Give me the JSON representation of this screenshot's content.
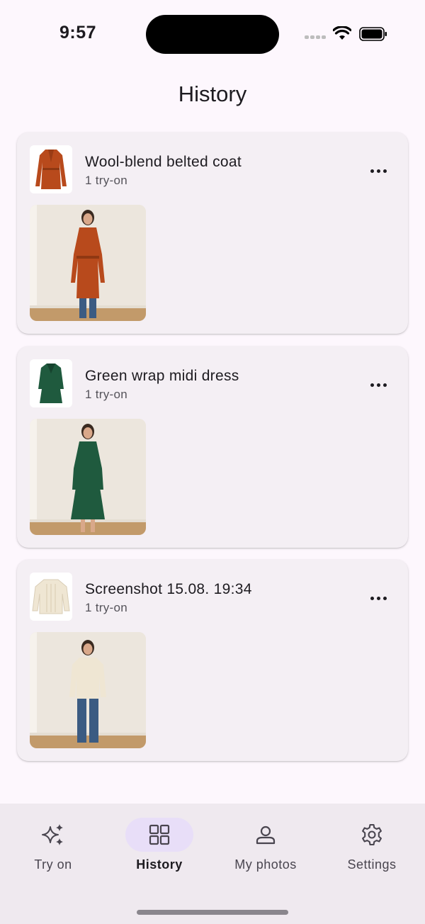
{
  "status_bar": {
    "time": "9:57"
  },
  "page": {
    "title": "History"
  },
  "cards": [
    {
      "title": "Wool-blend belted coat",
      "subtitle": "1 try-on",
      "garment_color": "#b84a1c"
    },
    {
      "title": "Green wrap midi dress",
      "subtitle": "1 try-on",
      "garment_color": "#1f5a3e"
    },
    {
      "title": "Screenshot 15.08. 19:34",
      "subtitle": "1 try-on",
      "garment_color": "#efe6d3"
    }
  ],
  "nav": {
    "items": [
      {
        "label": "Try on",
        "icon": "sparkle-icon",
        "active": false
      },
      {
        "label": "History",
        "icon": "grid-icon",
        "active": true
      },
      {
        "label": "My photos",
        "icon": "person-icon",
        "active": false
      },
      {
        "label": "Settings",
        "icon": "gear-icon",
        "active": false
      }
    ]
  },
  "colors": {
    "background": "#fdf7fd",
    "card": "#f4eff4",
    "nav_active": "#e8def8"
  }
}
